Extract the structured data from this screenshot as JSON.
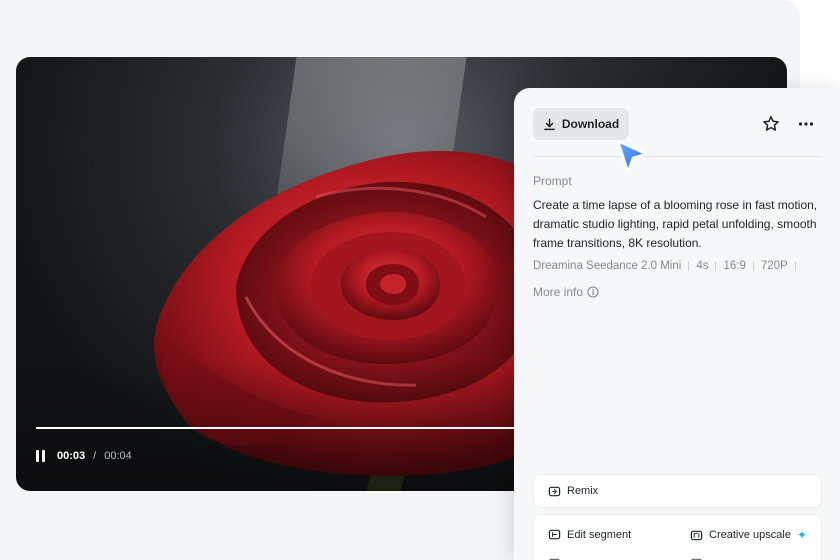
{
  "player": {
    "current_time": "00:03",
    "separator": "/",
    "total_time": "00:04",
    "progress_fraction": 0.75
  },
  "panel": {
    "download_label": "Download",
    "prompt_label": "Prompt",
    "prompt_text": "Create a time lapse of a blooming rose in fast motion, dramatic studio lighting, rapid petal unfolding, smooth frame transitions, 8K resolution.",
    "meta": [
      "Dreamina Seedance 2.0 Mini",
      "4s",
      "16:9",
      "720P"
    ],
    "more_info_label": "More info",
    "remix_label": "Remix",
    "tools": {
      "edit_segment": "Edit segment",
      "creative_upscale": "Creative upscale"
    }
  },
  "icons": {
    "download": "download-icon",
    "star": "star-icon",
    "more": "more-horizontal-icon",
    "info": "info-icon",
    "remix": "remix-icon",
    "edit_segment": "edit-segment-icon",
    "upscale": "upscale-icon",
    "cursor": "cursor-arrow-icon"
  },
  "colors": {
    "cursor": "#3d8bff",
    "sparkle": "#16b6d8"
  }
}
